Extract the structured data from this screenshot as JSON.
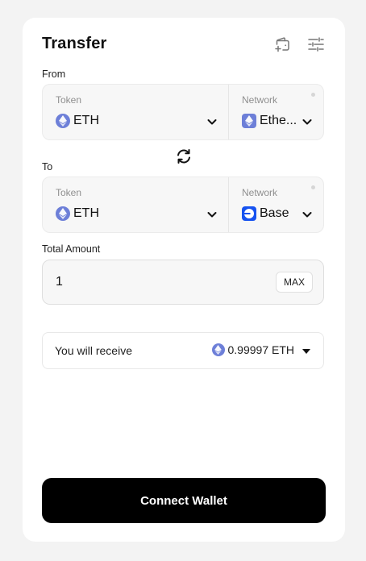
{
  "header": {
    "title": "Transfer",
    "wallet_icon": "wallet-plus-icon",
    "settings_icon": "sliders-icon"
  },
  "from": {
    "label": "From",
    "token_label": "Token",
    "token_value": "ETH",
    "network_label": "Network",
    "network_value": "Ethe..."
  },
  "to": {
    "label": "To",
    "token_label": "Token",
    "token_value": "ETH",
    "network_label": "Network",
    "network_value": "Base"
  },
  "amount": {
    "label": "Total Amount",
    "value": "1",
    "max_label": "MAX"
  },
  "receive": {
    "label": "You will receive",
    "value": "0.99997 ETH"
  },
  "connect_label": "Connect Wallet",
  "colors": {
    "eth": "#6d7fd8",
    "base": "#1652f0",
    "button": "#000000",
    "background": "#f3f3f3"
  }
}
